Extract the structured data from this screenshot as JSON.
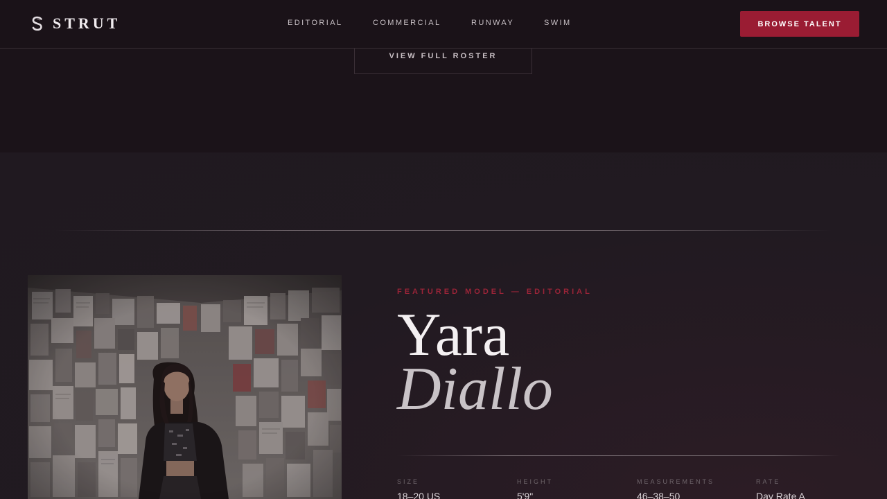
{
  "brand": {
    "name": "STRUT",
    "icon": "s-logo-icon"
  },
  "nav": {
    "items": [
      {
        "label": "EDITORIAL"
      },
      {
        "label": "COMMERCIAL"
      },
      {
        "label": "RUNWAY"
      },
      {
        "label": "SWIM"
      }
    ],
    "cta_label": "BROWSE TALENT"
  },
  "roster": {
    "button_label": "VIEW FULL ROSTER"
  },
  "featured": {
    "eyebrow": "FEATURED MODEL — EDITORIAL",
    "first_name": "Yara",
    "last_name": "Diallo",
    "stats": [
      {
        "label": "SIZE",
        "value": "18–20 US"
      },
      {
        "label": "HEIGHT",
        "value": "5'9\""
      },
      {
        "label": "MEASUREMENTS",
        "value": "46–38–50"
      },
      {
        "label": "RATE",
        "value": "Day Rate A"
      }
    ]
  },
  "colors": {
    "accent": "#9a1c33",
    "background": "#1b1319",
    "section_background": "#211a21"
  }
}
